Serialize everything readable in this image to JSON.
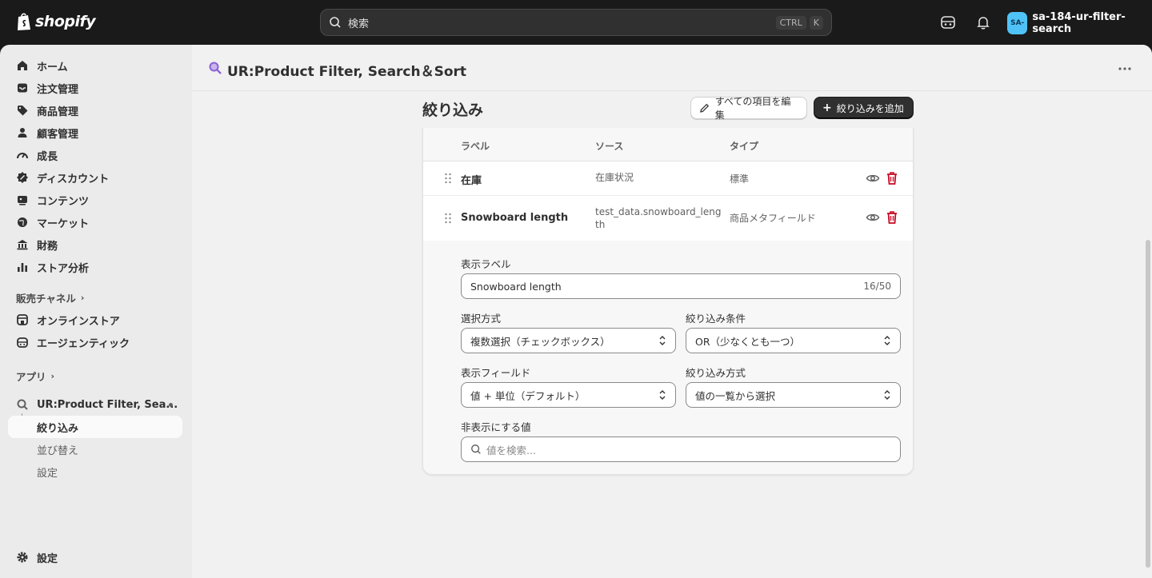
{
  "topbar": {
    "logo_text": "shopify",
    "search_placeholder": "検索",
    "shortcut_ctrl": "CTRL",
    "shortcut_k": "K",
    "store_avatar": "SA-",
    "store_name": "sa-184-ur-filter-search"
  },
  "sidebar": {
    "items": [
      {
        "label": "ホーム",
        "icon": "home-icon"
      },
      {
        "label": "注文管理",
        "icon": "inbox-icon"
      },
      {
        "label": "商品管理",
        "icon": "tag-icon"
      },
      {
        "label": "顧客管理",
        "icon": "person-icon"
      },
      {
        "label": "成長",
        "icon": "gauge-icon"
      },
      {
        "label": "ディスカウント",
        "icon": "discount-icon"
      },
      {
        "label": "コンテンツ",
        "icon": "content-icon"
      },
      {
        "label": "マーケット",
        "icon": "globe-icon"
      },
      {
        "label": "財務",
        "icon": "bank-icon"
      },
      {
        "label": "ストア分析",
        "icon": "chart-bar-icon"
      }
    ],
    "sales_channels_label": "販売チャネル",
    "channels": [
      {
        "label": "オンラインストア",
        "icon": "store-icon"
      },
      {
        "label": "エージェンティック",
        "icon": "agent-icon"
      }
    ],
    "apps_label": "アプリ",
    "app_name": "UR:Product Filter, Sea...",
    "app_subitems": [
      {
        "label": "絞り込み",
        "active": true
      },
      {
        "label": "並び替え",
        "active": false
      },
      {
        "label": "設定",
        "active": false
      }
    ],
    "settings_label": "設定"
  },
  "app_header": {
    "title": "UR:Product Filter, Search＆Sort"
  },
  "page": {
    "title": "絞り込み",
    "edit_all_button": "すべての項目を編集",
    "add_filter_button": "絞り込みを追加"
  },
  "table": {
    "headers": {
      "label": "ラベル",
      "source": "ソース",
      "type": "タイプ"
    },
    "rows": [
      {
        "label": "在庫",
        "source": "在庫状況",
        "type": "標準"
      },
      {
        "label": "Snowboard length",
        "source": "test_data.snowboard_length",
        "type": "商品メタフィールド"
      }
    ]
  },
  "detail": {
    "display_label_title": "表示ラベル",
    "display_label_value": "Snowboard length",
    "display_label_counter": "16/50",
    "selection_method_title": "選択方式",
    "selection_method_value": "複数選択（チェックボックス）",
    "filter_condition_title": "絞り込み条件",
    "filter_condition_value": "OR（少なくとも一つ）",
    "display_field_title": "表示フィールド",
    "display_field_value": "値 + 単位（デフォルト）",
    "filter_method_title": "絞り込み方式",
    "filter_method_value": "値の一覧から選択",
    "hidden_values_title": "非表示にする値",
    "hidden_values_placeholder": "値を検索..."
  },
  "colors": {
    "topbar_bg": "#1a1a1a",
    "sidebar_bg": "#ebebeb",
    "main_bg": "#f1f1f1",
    "primary_button": "#303030",
    "delete_red": "#c70a24",
    "avatar_bg": "#4fc3f7"
  }
}
